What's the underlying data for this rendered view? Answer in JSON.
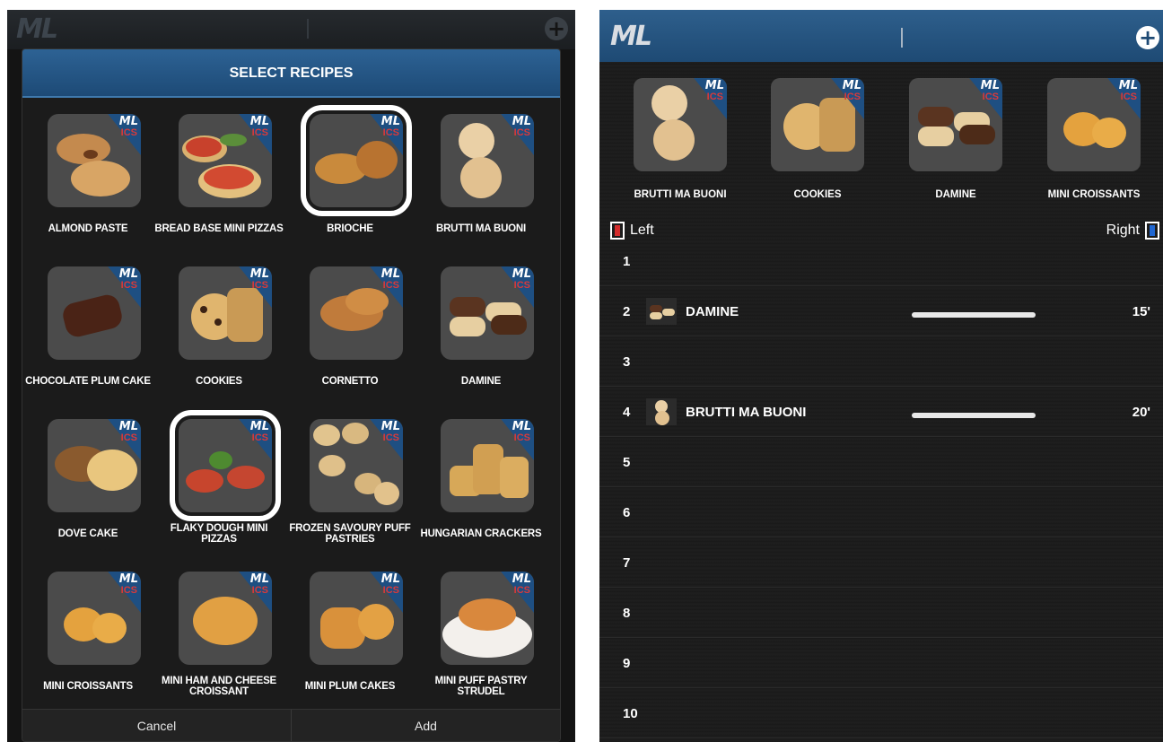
{
  "left": {
    "topbar": {
      "logo": "ML",
      "add_icon": "plus-circle-icon"
    },
    "dialog": {
      "title": "SELECT RECIPES",
      "badge_top": "ML",
      "badge_bottom": "ICS",
      "recipes": [
        {
          "label": "ALMOND PASTE",
          "selected": false
        },
        {
          "label": "BREAD BASE MINI PIZZAS",
          "selected": false
        },
        {
          "label": "BRIOCHE",
          "selected": true
        },
        {
          "label": "BRUTTI MA BUONI",
          "selected": false
        },
        {
          "label": "CHOCOLATE PLUM CAKE",
          "selected": false
        },
        {
          "label": "COOKIES",
          "selected": false
        },
        {
          "label": "CORNETTO",
          "selected": false
        },
        {
          "label": "DAMINE",
          "selected": false
        },
        {
          "label": "DOVE CAKE",
          "selected": false
        },
        {
          "label": "FLAKY DOUGH MINI PIZZAS",
          "selected": true
        },
        {
          "label": "FROZEN SAVOURY PUFF PASTRIES",
          "selected": false
        },
        {
          "label": "HUNGARIAN CRACKERS",
          "selected": false
        },
        {
          "label": "MINI CROISSANTS",
          "selected": false
        },
        {
          "label": "MINI HAM AND CHEESE CROISSANT",
          "selected": false
        },
        {
          "label": "MINI PLUM CAKES",
          "selected": false
        },
        {
          "label": "MINI PUFF PASTRY STRUDEL",
          "selected": false
        }
      ],
      "cancel_label": "Cancel",
      "add_label": "Add"
    }
  },
  "right": {
    "topbar": {
      "logo": "ML",
      "add_icon": "plus-circle-icon"
    },
    "favorites": [
      {
        "label": "BRUTTI MA BUONI"
      },
      {
        "label": "COOKIES"
      },
      {
        "label": "DAMINE"
      },
      {
        "label": "MINI CROISSANTS"
      }
    ],
    "badge_top": "ML",
    "badge_bottom": "ICS",
    "left_label": "Left",
    "right_label": "Right",
    "colors": {
      "left": "#d42b2b",
      "right": "#1f66d1",
      "accent": "#1e4a74"
    },
    "slots": [
      {
        "num": "1",
        "name": "",
        "time": ""
      },
      {
        "num": "2",
        "name": "DAMINE",
        "time": "15'"
      },
      {
        "num": "3",
        "name": "",
        "time": ""
      },
      {
        "num": "4",
        "name": "BRUTTI MA BUONI",
        "time": "20'"
      },
      {
        "num": "5",
        "name": "",
        "time": ""
      },
      {
        "num": "6",
        "name": "",
        "time": ""
      },
      {
        "num": "7",
        "name": "",
        "time": ""
      },
      {
        "num": "8",
        "name": "",
        "time": ""
      },
      {
        "num": "9",
        "name": "",
        "time": ""
      },
      {
        "num": "10",
        "name": "",
        "time": ""
      }
    ]
  }
}
